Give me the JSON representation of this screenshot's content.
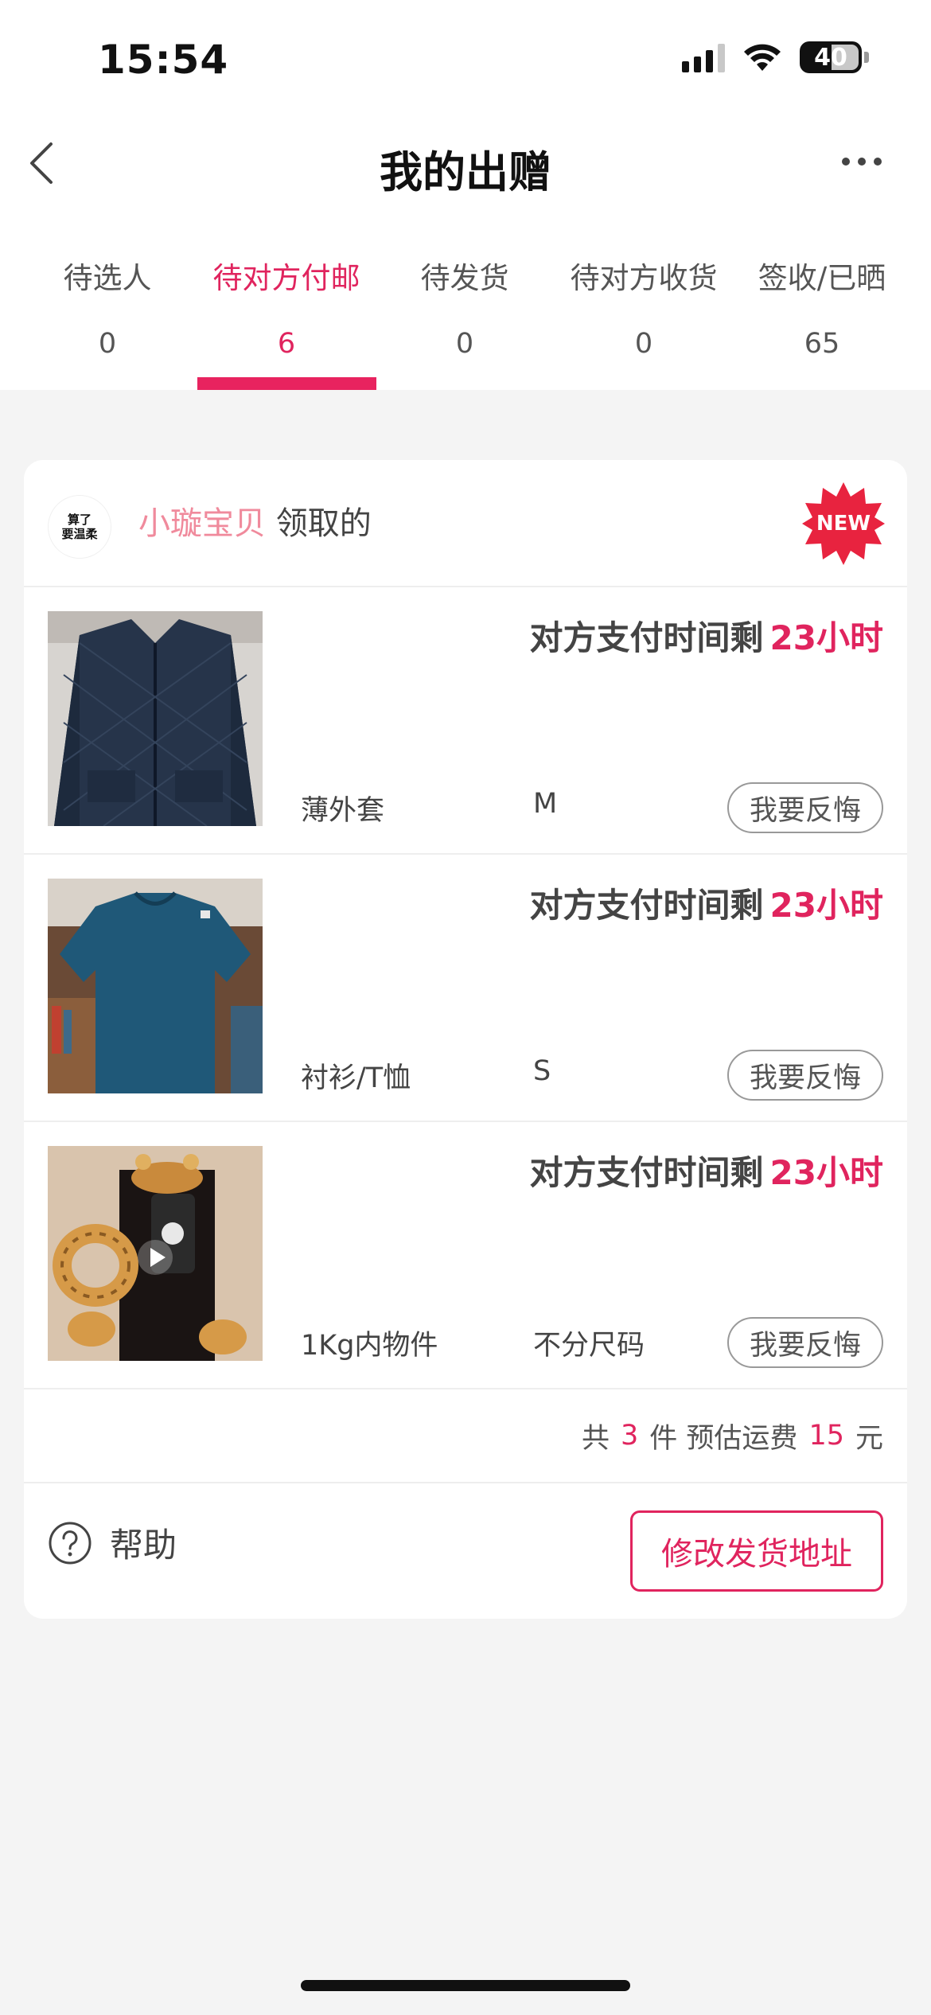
{
  "status_bar": {
    "time": "15:54",
    "battery": "40"
  },
  "nav": {
    "title": "我的出赠",
    "back_icon": "chevron-left-icon",
    "more_icon": "more-horizontal-icon"
  },
  "tabs": [
    {
      "label": "待选人",
      "count": "0",
      "active": false
    },
    {
      "label": "待对方付邮",
      "count": "6",
      "active": true
    },
    {
      "label": "待发货",
      "count": "0",
      "active": false
    },
    {
      "label": "待对方收货",
      "count": "0",
      "active": false
    },
    {
      "label": "签收/已晒",
      "count": "65",
      "active": false
    }
  ],
  "card": {
    "avatar_text": [
      "算了",
      "要温柔"
    ],
    "receiver_name": "小璇宝贝",
    "receiver_suffix": "领取的",
    "new_badge": "NEW",
    "items": [
      {
        "timer_label": "对方支付时间剩",
        "timer_hours": "23小时",
        "category": "薄外套",
        "size": "M",
        "regret_label": "我要反悔"
      },
      {
        "timer_label": "对方支付时间剩",
        "timer_hours": "23小时",
        "category": "衬衫/T恤",
        "size": "S",
        "regret_label": "我要反悔"
      },
      {
        "timer_label": "对方支付时间剩",
        "timer_hours": "23小时",
        "category": "1Kg内物件",
        "size": "不分尺码",
        "regret_label": "我要反悔"
      }
    ],
    "summary": {
      "prefix": "共",
      "count": "3",
      "middle": "件 预估运费",
      "fee": "15",
      "suffix": "元"
    },
    "help_label": "帮助",
    "address_button": "修改发货地址"
  },
  "colors": {
    "accent": "#e0245e",
    "receiver_name": "#f08a9c",
    "background": "#f4f4f4"
  }
}
